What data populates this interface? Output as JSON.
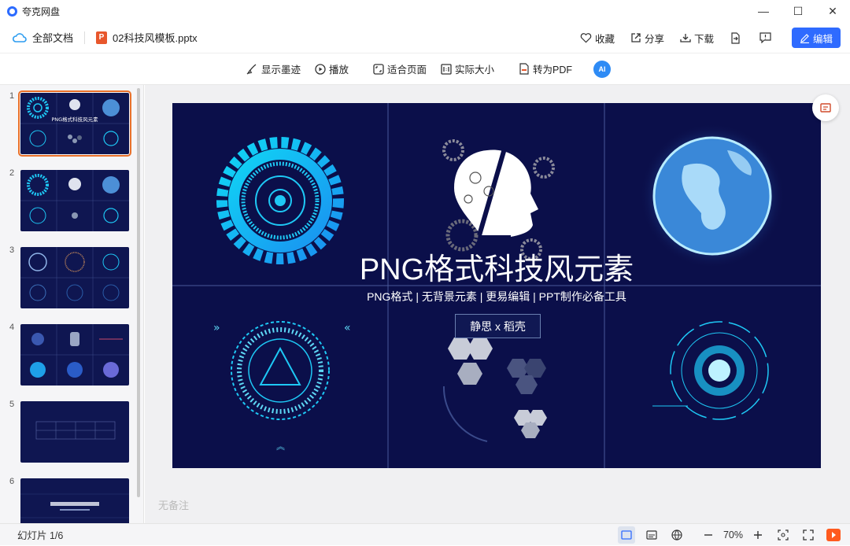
{
  "window": {
    "title": "夸克网盘",
    "minimize": "—",
    "maximize": "☐",
    "close": "✕"
  },
  "header": {
    "all_docs": "全部文档",
    "file_name": "02科技风模板.pptx",
    "file_type_badge": "P",
    "actions": {
      "favorite": "收藏",
      "share": "分享",
      "download": "下载",
      "edit": "编辑"
    }
  },
  "viewer_toolbar": {
    "show_ink": "显示墨迹",
    "play": "播放",
    "fit_page": "适合页面",
    "actual_size": "实际大小",
    "to_pdf": "转为PDF",
    "ai_badge": "AI"
  },
  "thumbnails": {
    "numbers": [
      "1",
      "2",
      "3",
      "4",
      "5",
      "6"
    ],
    "selected": "1"
  },
  "slide": {
    "title": "PNG格式科技风元素",
    "subtitle": "PNG格式 | 无背景元素 | 更易编辑 | PPT制作必备工具",
    "badge": "静思 x 稻壳",
    "colors": {
      "background": "#0b0f4a",
      "accent": "#1ec8f5"
    }
  },
  "notes_placeholder": "无备注",
  "status": {
    "slide_counter": "幻灯片 1/6",
    "zoom": "70%"
  },
  "colors": {
    "accent": "#2f6bff",
    "selection": "#e8702a"
  }
}
